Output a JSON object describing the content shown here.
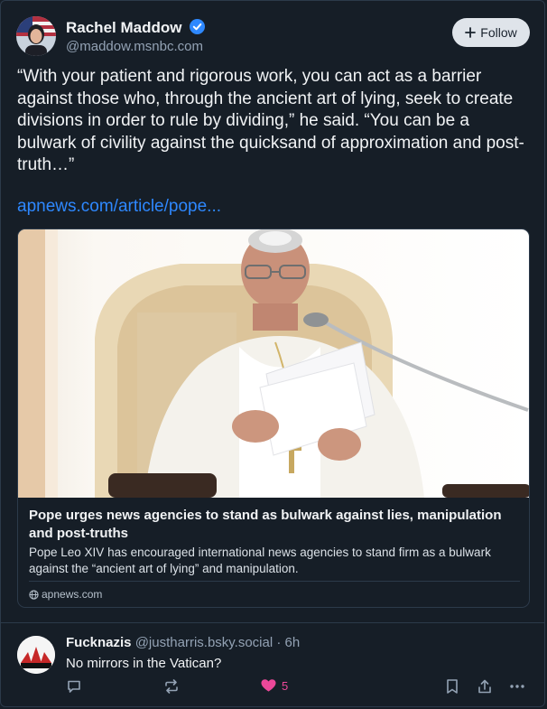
{
  "post": {
    "author_name": "Rachel Maddow",
    "author_handle": "@maddow.msnbc.com",
    "follow_label": "Follow",
    "text": "“With your patient and rigorous work, you can act as a barrier against those who, through the ancient art of lying, seek to create divisions in order to rule by dividing,” he said. “You can be a bulwark of civility against the quicksand of approximation and post-truth…”",
    "link_text": "apnews.com/article/pope..."
  },
  "card": {
    "title": "Pope urges news agencies to stand as bulwark against lies, manipulation and post-truths",
    "description": "Pope Leo XIV has encouraged international news agencies to stand firm as a bulwark against the “ancient art of lying” and manipulation.",
    "domain": "apnews.com"
  },
  "reply": {
    "author_name": "Fucknazis",
    "author_handle": "@justharris.bsky.social",
    "time_sep": " · ",
    "time": "6h",
    "text": "No mirrors in the Vatican?",
    "like_count": "5"
  },
  "colors": {
    "background": "#161e27",
    "link": "#2e88ff",
    "verified": "#2e88ff",
    "like": "#ec4899",
    "muted": "#93a2b4"
  },
  "icons": [
    "verified-badge-icon",
    "plus-icon",
    "globe-icon",
    "reply-icon",
    "repost-icon",
    "heart-icon",
    "bookmark-icon",
    "share-icon",
    "more-icon"
  ]
}
